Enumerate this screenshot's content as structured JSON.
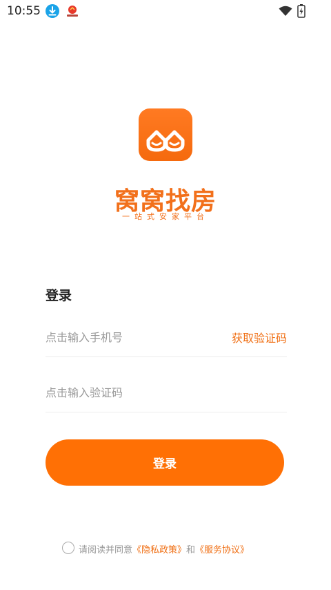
{
  "status_bar": {
    "time": "10:55",
    "icons": [
      "download-notification-icon",
      "app-notification-icon",
      "wifi-icon",
      "battery-charging-icon"
    ]
  },
  "brand": {
    "name": "窝窝找房",
    "tagline": "一站式安家平台",
    "color": "#f2701b"
  },
  "login": {
    "heading": "登录",
    "phone_placeholder": "点击输入手机号",
    "get_code_label": "获取验证码",
    "code_placeholder": "点击输入验证码",
    "submit_label": "登录"
  },
  "agreement": {
    "prefix": "请阅读并同意",
    "privacy_link": "《隐私政策》",
    "conjunction": "和",
    "service_link": "《服务协议》"
  },
  "colors": {
    "accent": "#ff7005",
    "link": "#f07016"
  }
}
